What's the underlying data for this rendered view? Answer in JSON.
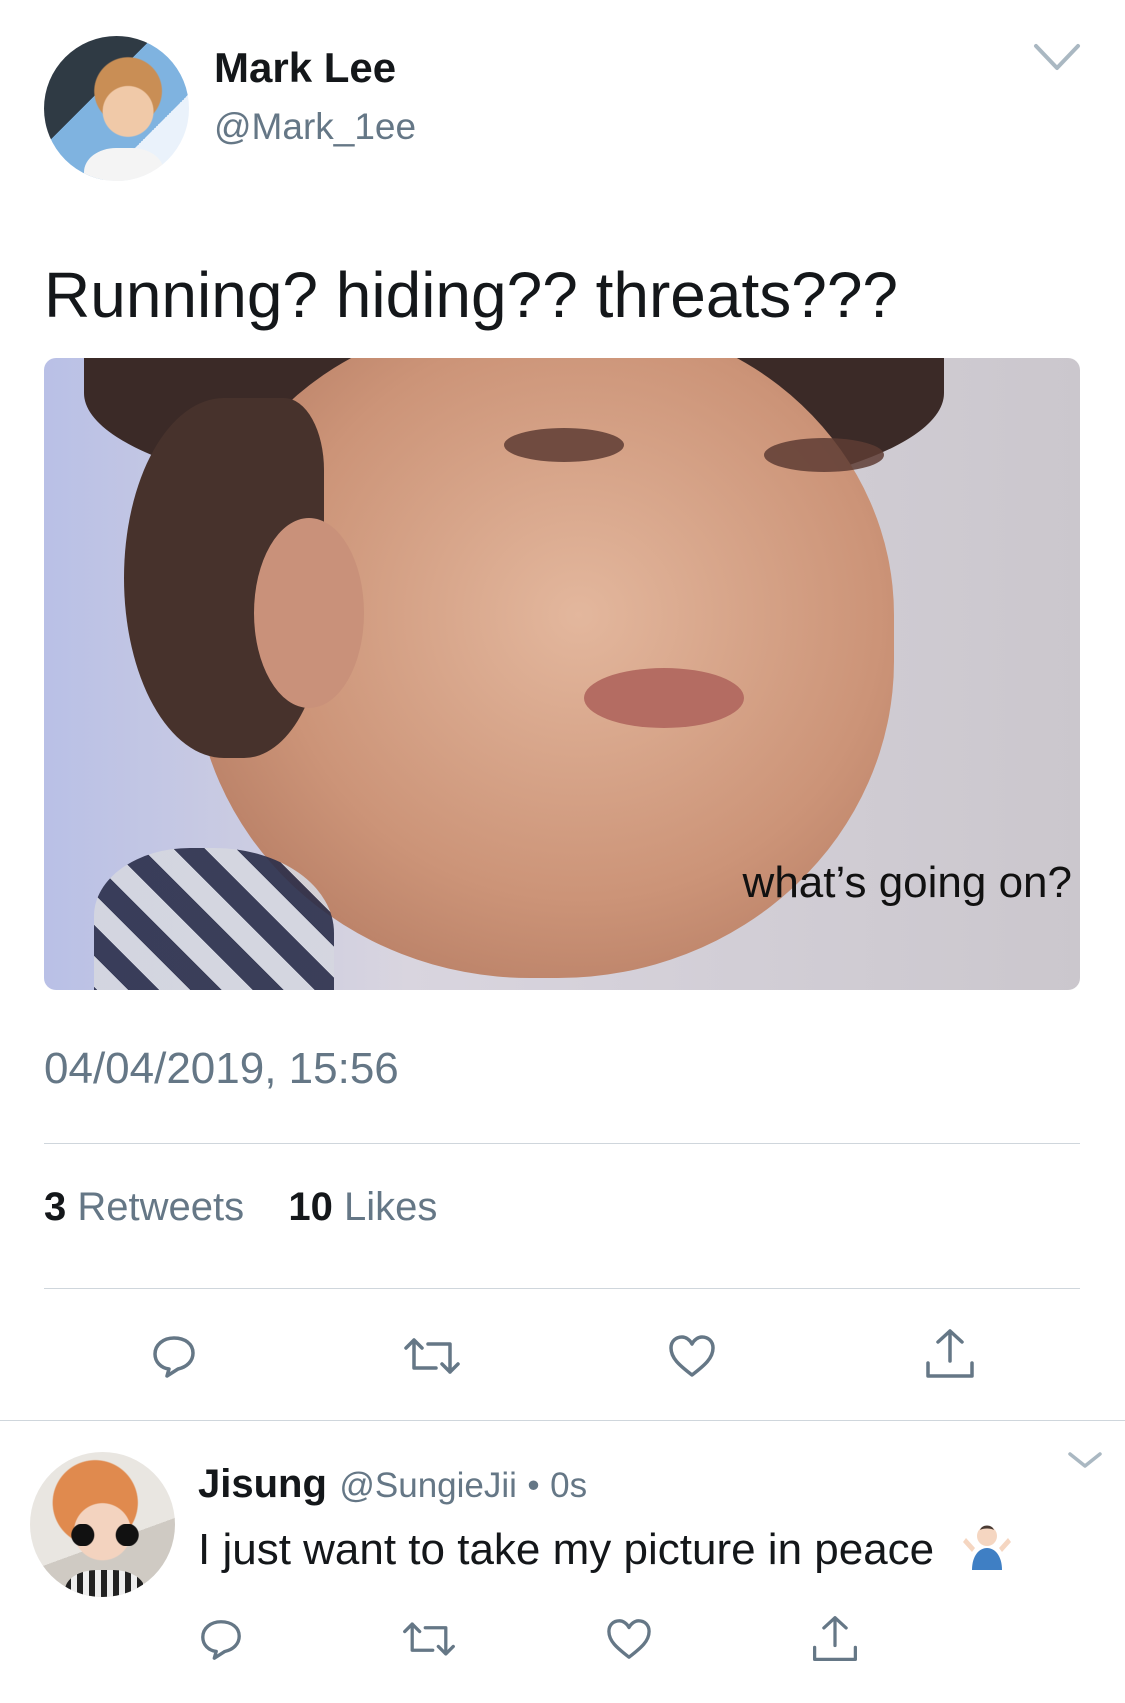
{
  "tweet": {
    "author": {
      "display_name": "Mark Lee",
      "handle": "@Mark_1ee",
      "avatar_icon": "profile-photo"
    },
    "text": "Running? hiding?? threats???",
    "media": {
      "caption": "what’s going on?"
    },
    "timestamp": "04/04/2019, 15:56",
    "stats": {
      "retweets_count": "3",
      "retweets_label": "Retweets",
      "likes_count": "10",
      "likes_label": "Likes"
    },
    "actions": [
      "reply-icon",
      "retweet-icon",
      "like-icon",
      "share-icon"
    ],
    "more_icon": "chevron-down-icon"
  },
  "reply": {
    "author": {
      "display_name": "Jisung",
      "handle": "@SungieJii",
      "avatar_icon": "profile-photo"
    },
    "separator": "•",
    "time": "0s",
    "text": "I just want to take my picture in peace",
    "emoji": "man-shrugging-emoji",
    "actions": [
      "reply-icon",
      "retweet-icon",
      "like-icon",
      "share-icon"
    ],
    "more_icon": "chevron-down-icon"
  },
  "colors": {
    "primary_text": "#14171a",
    "secondary_text": "#657786",
    "divider": "#cfd6dc",
    "icon": "#657786",
    "background": "#ffffff"
  }
}
